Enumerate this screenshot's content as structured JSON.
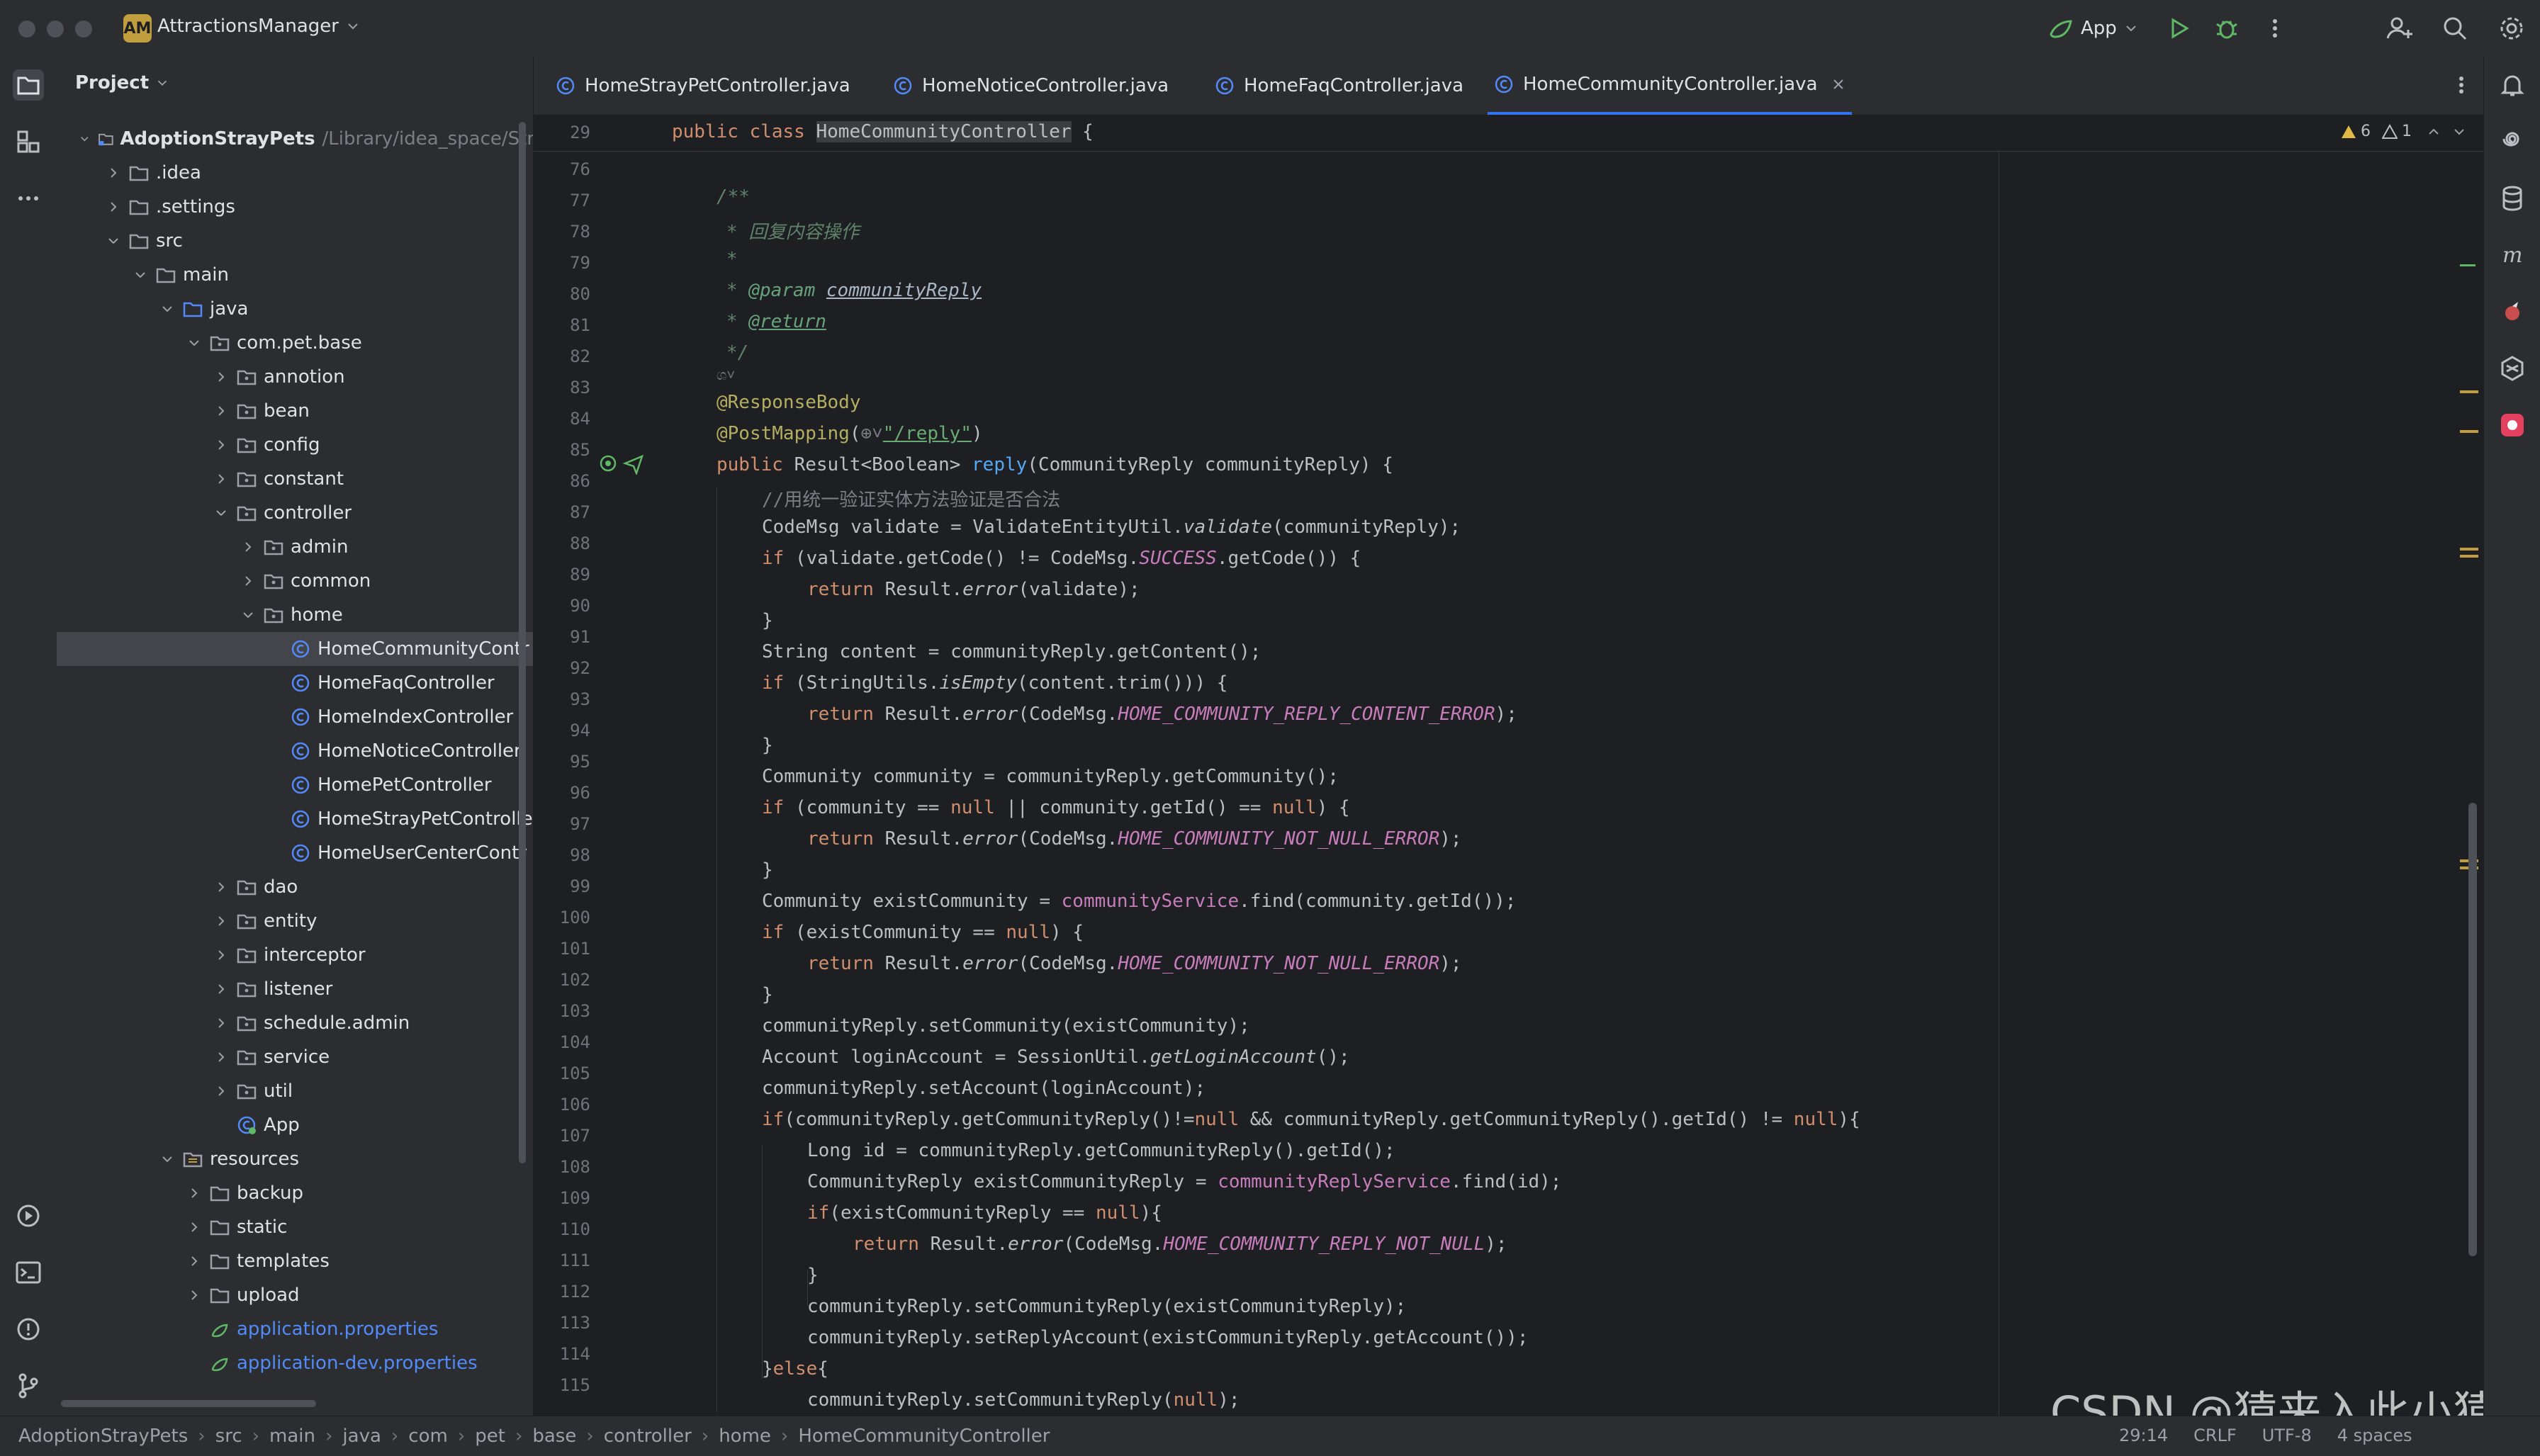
{
  "titlebar": {
    "project_badge": "AM",
    "project_name": "AttractionsManager",
    "run_config": "App"
  },
  "project_panel": {
    "title": "Project",
    "root": {
      "name": "AdoptionStrayPets",
      "path": "/Library/idea_space/Stra"
    },
    "items": [
      {
        "label": ".idea"
      },
      {
        "label": ".settings"
      },
      {
        "label": "src"
      },
      {
        "label": "main"
      },
      {
        "label": "java"
      },
      {
        "label": "com.pet.base"
      },
      {
        "label": "annotion"
      },
      {
        "label": "bean"
      },
      {
        "label": "config"
      },
      {
        "label": "constant"
      },
      {
        "label": "controller"
      },
      {
        "label": "admin"
      },
      {
        "label": "common"
      },
      {
        "label": "home"
      },
      {
        "label": "HomeCommunityContr"
      },
      {
        "label": "HomeFaqController"
      },
      {
        "label": "HomeIndexController"
      },
      {
        "label": "HomeNoticeController"
      },
      {
        "label": "HomePetController"
      },
      {
        "label": "HomeStrayPetControlle"
      },
      {
        "label": "HomeUserCenterContr"
      },
      {
        "label": "dao"
      },
      {
        "label": "entity"
      },
      {
        "label": "interceptor"
      },
      {
        "label": "listener"
      },
      {
        "label": "schedule.admin"
      },
      {
        "label": "service"
      },
      {
        "label": "util"
      },
      {
        "label": "App"
      },
      {
        "label": "resources"
      },
      {
        "label": "backup"
      },
      {
        "label": "static"
      },
      {
        "label": "templates"
      },
      {
        "label": "upload"
      },
      {
        "label": "application.properties"
      },
      {
        "label": "application-dev.properties"
      }
    ]
  },
  "tabs": [
    {
      "label": "HomeStrayPetController.java"
    },
    {
      "label": "HomeNoticeController.java"
    },
    {
      "label": "HomeFaqController.java"
    },
    {
      "label": "HomeCommunityController.java"
    }
  ],
  "editor": {
    "sticky_line": "29",
    "inspections": {
      "warnings": "6",
      "weak_warnings": "1"
    },
    "line_numbers": [
      "76",
      "77",
      "78",
      "79",
      "80",
      "81",
      "82",
      "83",
      "84",
      "85",
      "86",
      "87",
      "88",
      "89",
      "90",
      "91",
      "92",
      "93",
      "94",
      "95",
      "96",
      "97",
      "98",
      "99",
      "100",
      "101",
      "102",
      "103",
      "104",
      "105",
      "106",
      "107",
      "108",
      "109",
      "110",
      "111",
      "112",
      "113",
      "114",
      "115"
    ],
    "javadoc_title": "回复内容操作",
    "comment_validate": "//用统一验证实体方法验证是否合法",
    "mapping_path": "\"/reply\"",
    "param_name": "communityReply",
    "const_success": "SUCCESS",
    "const_content_error": "HOME_COMMUNITY_REPLY_CONTENT_ERROR",
    "const_not_null_error": "HOME_COMMUNITY_NOT_NULL_ERROR",
    "const_reply_not_null": "HOME_COMMUNITY_REPLY_NOT_NULL"
  },
  "statusbar": {
    "breadcrumbs": [
      "AdoptionStrayPets",
      "src",
      "main",
      "java",
      "com",
      "pet",
      "base",
      "controller",
      "home",
      "HomeCommunityController"
    ],
    "position": "29:14",
    "line_sep": "CRLF",
    "encoding": "UTF-8",
    "indent": "4 spaces"
  },
  "watermark": "CSDN @猿来入此小猿",
  "colors": {
    "accent": "#3574f0",
    "keyword": "#cf8e6d",
    "annotation": "#b3ae60",
    "function": "#56a8f5",
    "field": "#c77dbb",
    "string": "#6aab73"
  }
}
